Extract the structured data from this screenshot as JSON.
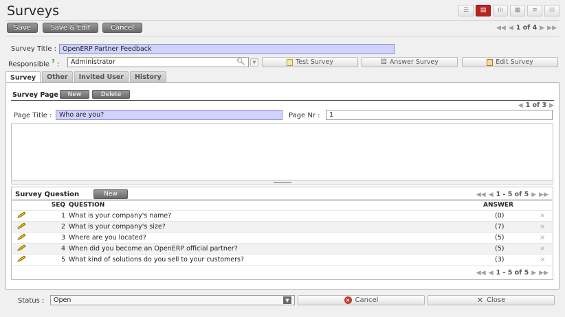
{
  "header": {
    "title": "Surveys",
    "view_icons": [
      "list-view-icon",
      "form-view-icon",
      "graph-view-icon",
      "calendar-view-icon",
      "gantt-view-icon",
      "diagram-view-icon"
    ],
    "active_view": "form-view-icon"
  },
  "toolbar": {
    "save_label": "Save",
    "save_edit_label": "Save & Edit",
    "cancel_label": "Cancel",
    "pager_count": "1 of 4"
  },
  "form": {
    "survey_title_label": "Survey Title :",
    "survey_title_value": "OpenERP Partner Feedback",
    "responsible_label": "Responsible",
    "responsible_help": "?",
    "responsible_colon": ":",
    "responsible_value": "Administrator",
    "test_survey_label": "Test Survey",
    "answer_survey_label": "Answer Survey",
    "edit_survey_label": "Edit Survey"
  },
  "tabs": [
    {
      "label": "Survey",
      "active": true
    },
    {
      "label": "Other",
      "active": false
    },
    {
      "label": "Invited User",
      "active": false
    },
    {
      "label": "History",
      "active": false
    }
  ],
  "survey_page": {
    "header": "Survey Page",
    "new_label": "New",
    "delete_label": "Delete",
    "pager_count": "1 of 3",
    "page_title_label": "Page Title :",
    "page_title_value": "Who are you?",
    "page_nr_label": "Page Nr :",
    "page_nr_value": "1"
  },
  "survey_question": {
    "header": "Survey Question",
    "new_label": "New",
    "pager_count": "1 - 5 of 5",
    "columns": {
      "seq": "SEQ",
      "question": "QUESTION",
      "answer": "ANSWER"
    },
    "rows": [
      {
        "seq": "1",
        "question": "What is your company's name?",
        "answer": "(0)"
      },
      {
        "seq": "2",
        "question": "What is your company's size?",
        "answer": "(7)"
      },
      {
        "seq": "3",
        "question": "Where are you located?",
        "answer": "(5)"
      },
      {
        "seq": "4",
        "question": "When did you become an OpenERP official partner?",
        "answer": "(5)"
      },
      {
        "seq": "5",
        "question": "What kind of solutions do you sell to your customers?",
        "answer": "(3)"
      }
    ],
    "delete_glyph": "×"
  },
  "footer": {
    "status_label": "Status :",
    "status_value": "Open",
    "cancel_label": "Cancel",
    "close_label": "Close"
  },
  "colors": {
    "required_field": "#d2d2ff",
    "active_view": "#bb2222",
    "cancel_icon": "#c0392b"
  }
}
